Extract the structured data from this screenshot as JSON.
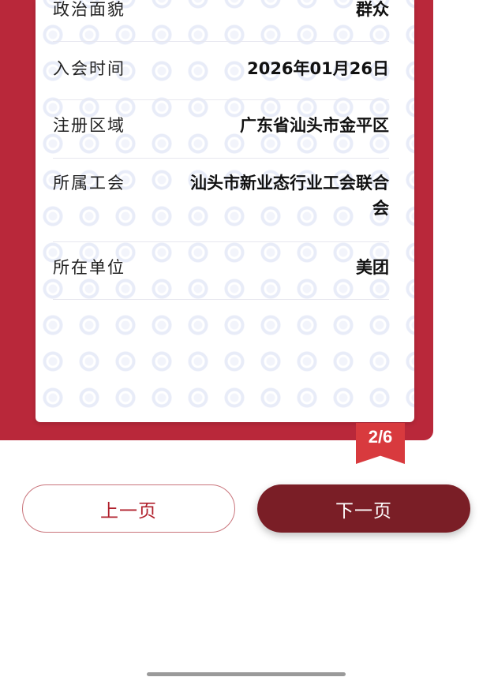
{
  "fields": [
    {
      "label": "政治面貌",
      "value": "群众"
    },
    {
      "label": "入会时间",
      "value": "2026年01月26日"
    },
    {
      "label": "注册区域",
      "value": "广东省汕头市金平区"
    },
    {
      "label": "所属工会",
      "value": "汕头市新业态行业工会联合会"
    },
    {
      "label": "所在单位",
      "value": "美团"
    }
  ],
  "pager": {
    "indicator": "2/6"
  },
  "buttons": {
    "prev_label": "上一页",
    "next_label": "下一页"
  },
  "colors": {
    "frame": "#b9283a",
    "ribbon": "#d83a3e",
    "next_button": "#7a1e26",
    "prev_text": "#b0202c"
  }
}
